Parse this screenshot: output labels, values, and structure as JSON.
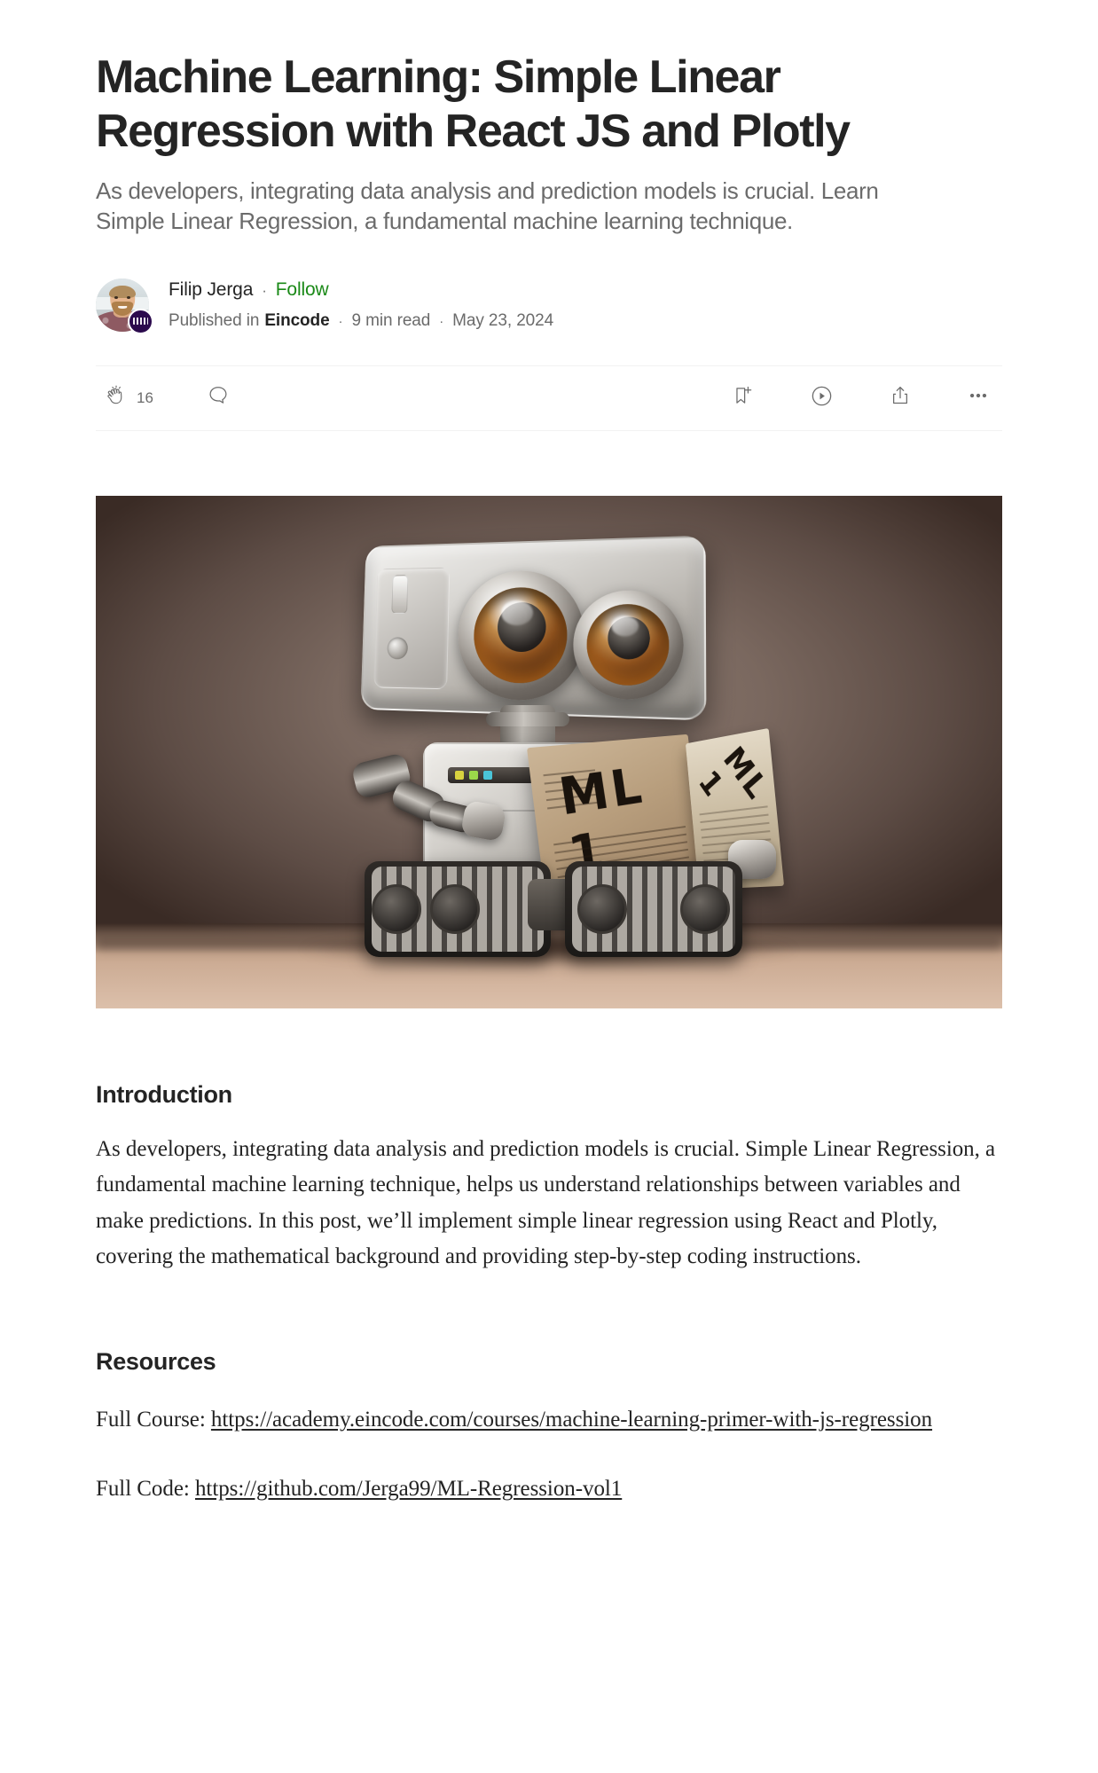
{
  "article": {
    "title": "Machine Learning: Simple Linear Regression with React JS and Plotly",
    "subtitle": "As developers, integrating data analysis and prediction models is crucial. Learn Simple Linear Regression, a fundamental machine learning technique."
  },
  "byline": {
    "author_name": "Filip Jerga",
    "separator": "·",
    "follow_label": "Follow",
    "published_in_label": "Published in",
    "publication": "Eincode",
    "read_time": "9 min read",
    "date": "May 23, 2024",
    "avatar_alt": "avatar",
    "badge_alt": "eincode-badge"
  },
  "actions": {
    "clap_icon": "clap-icon",
    "clap_count": "16",
    "comment_icon": "comment-icon",
    "bookmark_icon": "bookmark-add-icon",
    "listen_icon": "play-listen-icon",
    "share_icon": "share-icon",
    "more_icon": "more-ellipsis-icon"
  },
  "hero": {
    "alt": "Robot reading a book titled ML 1",
    "book_title_front": "ML 1",
    "book_title_spine": "ML 1"
  },
  "sections": {
    "introduction": {
      "heading": "Introduction",
      "paragraph": "As developers, integrating data analysis and prediction models is crucial. Simple Linear Regression, a fundamental machine learning technique, helps us understand relationships between variables and make predictions. In this post, we’ll implement simple linear regression using React and Plotly, covering the mathematical background and providing step-by-step coding instructions."
    },
    "resources": {
      "heading": "Resources",
      "full_course_label": "Full Course: ",
      "full_course_link": "https://academy.eincode.com/courses/machine-learning-primer-with-js-regression",
      "full_code_label": "Full Code: ",
      "full_code_link": "https://github.com/Jerga99/ML-Regression-vol1"
    }
  },
  "colors": {
    "text_primary": "#242424",
    "text_secondary": "#6B6B6B",
    "accent_follow": "#1A8917",
    "badge_purple": "#2B0A4D",
    "divider": "#F2F2F2"
  }
}
